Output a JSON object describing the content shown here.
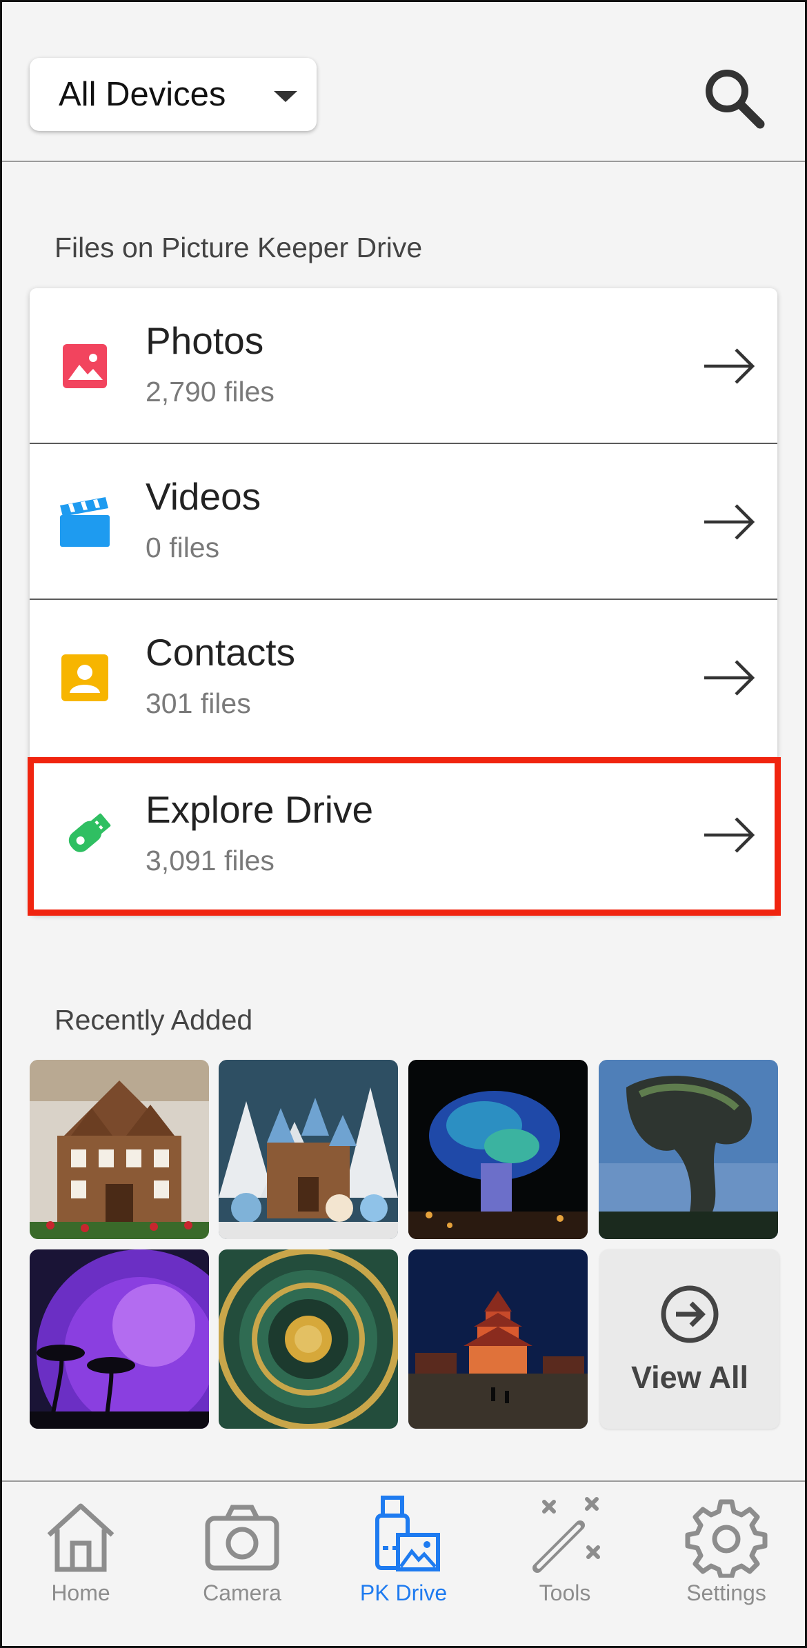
{
  "header": {
    "device_select": "All Devices",
    "search_icon": "search-icon"
  },
  "files_section": {
    "label": "Files on Picture Keeper Drive",
    "rows": [
      {
        "title": "Photos",
        "count": "2,790 files",
        "icon": "photo-icon",
        "color": "#f2445e"
      },
      {
        "title": "Videos",
        "count": "0 files",
        "icon": "clapperboard-icon",
        "color": "#1e9bf0"
      },
      {
        "title": "Contacts",
        "count": "301 files",
        "icon": "contact-card-icon",
        "color": "#f7b500"
      },
      {
        "title": "Explore Drive",
        "count": "3,091 files",
        "icon": "usb-drive-icon",
        "color": "#2fbf62"
      }
    ],
    "highlight_color": "#f0240f"
  },
  "recent": {
    "label": "Recently Added",
    "view_all": "View All"
  },
  "tabbar": {
    "active_color": "#1e7bf0",
    "items": [
      {
        "label": "Home",
        "icon": "home-icon"
      },
      {
        "label": "Camera",
        "icon": "camera-icon"
      },
      {
        "label": "PK Drive",
        "icon": "pk-drive-icon",
        "active": true
      },
      {
        "label": "Tools",
        "icon": "magic-wand-icon"
      },
      {
        "label": "Settings",
        "icon": "gear-icon"
      }
    ]
  }
}
